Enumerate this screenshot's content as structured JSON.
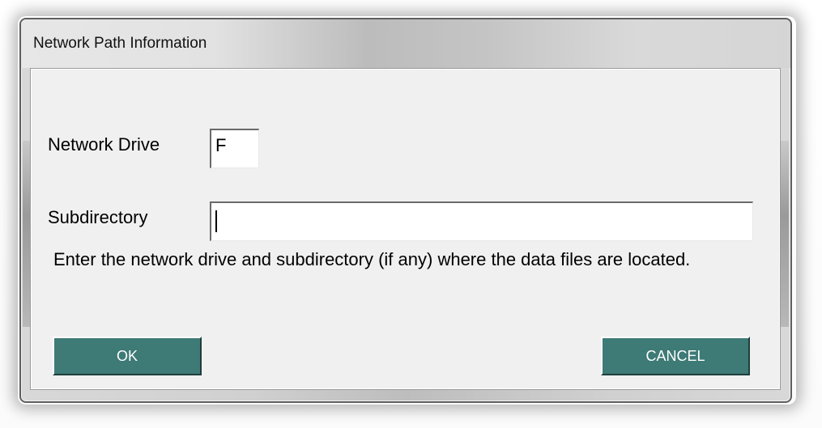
{
  "window": {
    "title": "Network Path Information"
  },
  "form": {
    "network_drive": {
      "label": "Network Drive",
      "value": "F"
    },
    "subdirectory": {
      "label": "Subdirectory",
      "value": ""
    },
    "message": "Enter the network drive and subdirectory (if any)  where the data files are located."
  },
  "buttons": {
    "ok_label": "OK",
    "cancel_label": "CANCEL"
  },
  "colors": {
    "button_bg": "#3e7a76",
    "client_bg": "#f0f0f0"
  }
}
